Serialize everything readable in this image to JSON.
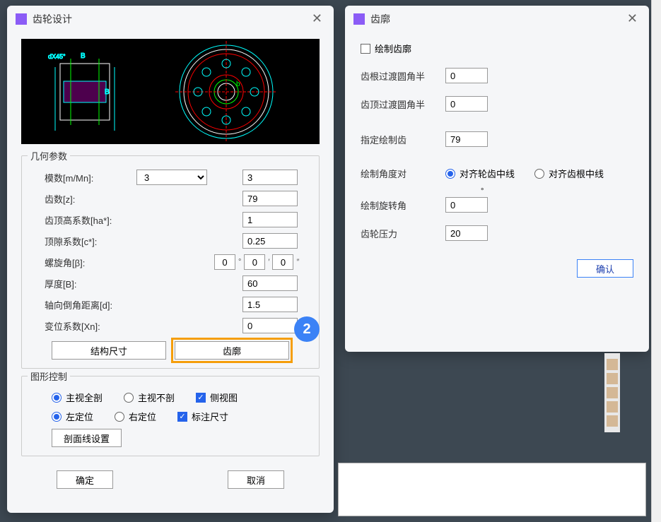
{
  "dialog1": {
    "title": "齿轮设计",
    "geometry": {
      "legend": "几何参数",
      "modulus_label": "模数[m/Mn]:",
      "modulus_select": "3",
      "modulus_value": "3",
      "teeth_label": "齿数[z]:",
      "teeth_value": "79",
      "addendum_label": "齿顶高系数[ha*]:",
      "addendum_value": "1",
      "clearance_label": "顶隙系数[c*]:",
      "clearance_value": "0.25",
      "helix_label": "螺旋角[β]:",
      "helix_deg": "0",
      "helix_min": "0",
      "helix_sec": "0",
      "thickness_label": "厚度[B]:",
      "thickness_value": "60",
      "chamfer_label": "轴向倒角距离[d]:",
      "chamfer_value": "1.5",
      "shift_label": "变位系数[Xn]:",
      "shift_value": "0",
      "btn_structure": "结构尺寸",
      "btn_profile": "齿廓"
    },
    "graphics": {
      "legend": "图形控制",
      "main_full_section": "主视全剖",
      "main_no_section": "主视不剖",
      "side_view": "侧视图",
      "left_align": "左定位",
      "right_align": "右定位",
      "dim_label": "标注尺寸",
      "hatch_btn": "剖面线设置"
    },
    "ok": "确定",
    "cancel": "取消"
  },
  "dialog2": {
    "title": "齿廓",
    "draw_profile": "绘制齿廓",
    "root_fillet_label": "齿根过渡圆角半",
    "root_fillet_value": "0",
    "tip_fillet_label": "齿顶过渡圆角半",
    "tip_fillet_value": "0",
    "spec_teeth_label": "指定绘制齿",
    "spec_teeth_value": "79",
    "angle_align_label": "绘制角度对",
    "align_tooth_center": "对齐轮齿中线",
    "align_root_center": "对齐齿根中线",
    "rotation_label": "绘制旋转角",
    "rotation_value": "0",
    "pressure_label": "齿轮压力",
    "pressure_value": "20",
    "ok": "确认"
  },
  "step_number": "2",
  "diagram_label": "dX45"
}
